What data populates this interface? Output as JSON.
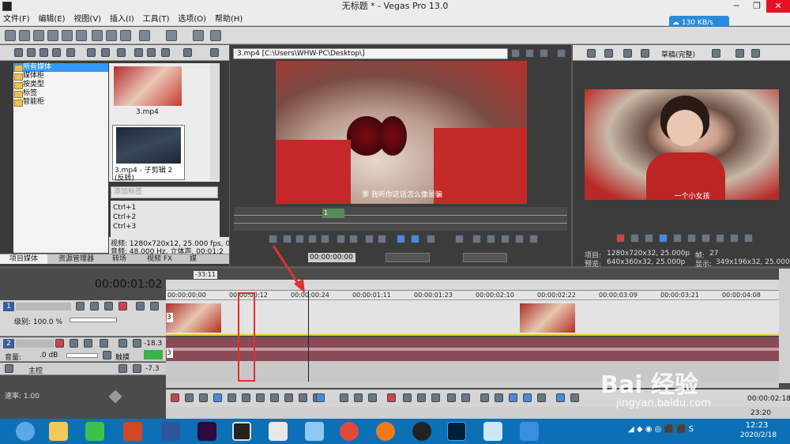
{
  "window": {
    "title": "无标题 * - Vegas Pro 13.0",
    "minimize": "─",
    "maximize": "❐",
    "close": "✕"
  },
  "menu": [
    "文件(F)",
    "编辑(E)",
    "视图(V)",
    "插入(I)",
    "工具(T)",
    "选项(O)",
    "帮助(H)"
  ],
  "net_badge": {
    "text": "130 KB/s",
    "icon": "cloud-speed-icon"
  },
  "explorer": {
    "tree": [
      "所有媒体",
      "媒体柜",
      "按类型",
      "标签",
      "智能柜"
    ],
    "thumbs": [
      {
        "label": "3.mp4"
      },
      {
        "label": "3.mp4 - 子剪辑 2 (反转)"
      }
    ],
    "tag_placeholder": "添加标签",
    "shortcuts": [
      "Ctrl+1",
      "Ctrl+2",
      "Ctrl+3"
    ],
    "info_video": "视频: 1280x720x12, 25.000 fps, 0",
    "info_audio": "音频: 48,000 Hz, 立体声, 00:01:2",
    "tabs": [
      "项目媒体",
      "资源管理器",
      "转场",
      "视频 FX",
      "媒"
    ]
  },
  "trimmer": {
    "path": "3.mp4     [C:\\Users\\WHW-PC\\Desktop\\]",
    "subtitle": "爹 我听你这话怎么像是骗",
    "marker": "1 ",
    "time": "00:00:00:00"
  },
  "preview": {
    "quality": "草稿(完整)",
    "subtitle": "一个小女孩",
    "project_label": "项目:",
    "project_value": "1280x720x32, 25.000p",
    "frame_label": "帧:",
    "frame_value": "27",
    "preview_label": "预览:",
    "preview_value": "640x360x32, 25.000p",
    "display_label": "显示:",
    "display_value": "349x196x32, 25.000"
  },
  "timeline": {
    "current_time": "00:00:01:02",
    "cursor_label": "-33:11",
    "ruler": [
      "00:00:00:00",
      "00:00:00:12",
      "00:00:00:24",
      "00:00:01:11",
      "00:00:01:23",
      "00:00:02:10",
      "00:00:02:22",
      "00:00:03:09",
      "00:00:03:21",
      "00:00:04:08"
    ],
    "video_track": {
      "num": "1",
      "level": "级别: 100.0 %",
      "clip_label": "3"
    },
    "audio_track": {
      "num": "2",
      "volume": "音量:",
      "db": ".0 dB",
      "pan": "触摸",
      "meter": "-18.3",
      "clip_label": "3"
    },
    "master": {
      "label": "主控",
      "meter": "-7.3"
    },
    "rate": "速率: 1.00",
    "end_time": "00:00:02:18",
    "end_time2": "23:20"
  },
  "taskbar": {
    "apps": [
      "browser",
      "explorer",
      "wechat",
      "powerpoint",
      "word",
      "premiere",
      "vegas",
      "music",
      "qq-browser",
      "chrome",
      "fox",
      "qq",
      "photoshop",
      "notes",
      "wps"
    ],
    "tray_time": "12:23",
    "tray_date": "2020/2/18"
  },
  "watermark": {
    "text": "Bai 经验",
    "sub": "jingyan.baidu.com"
  },
  "colors": {
    "accent": "#3399ff",
    "title": "#ececec",
    "panel": "#3a3a3a",
    "audio": "#8b4b56",
    "highlight": "#e03030"
  }
}
